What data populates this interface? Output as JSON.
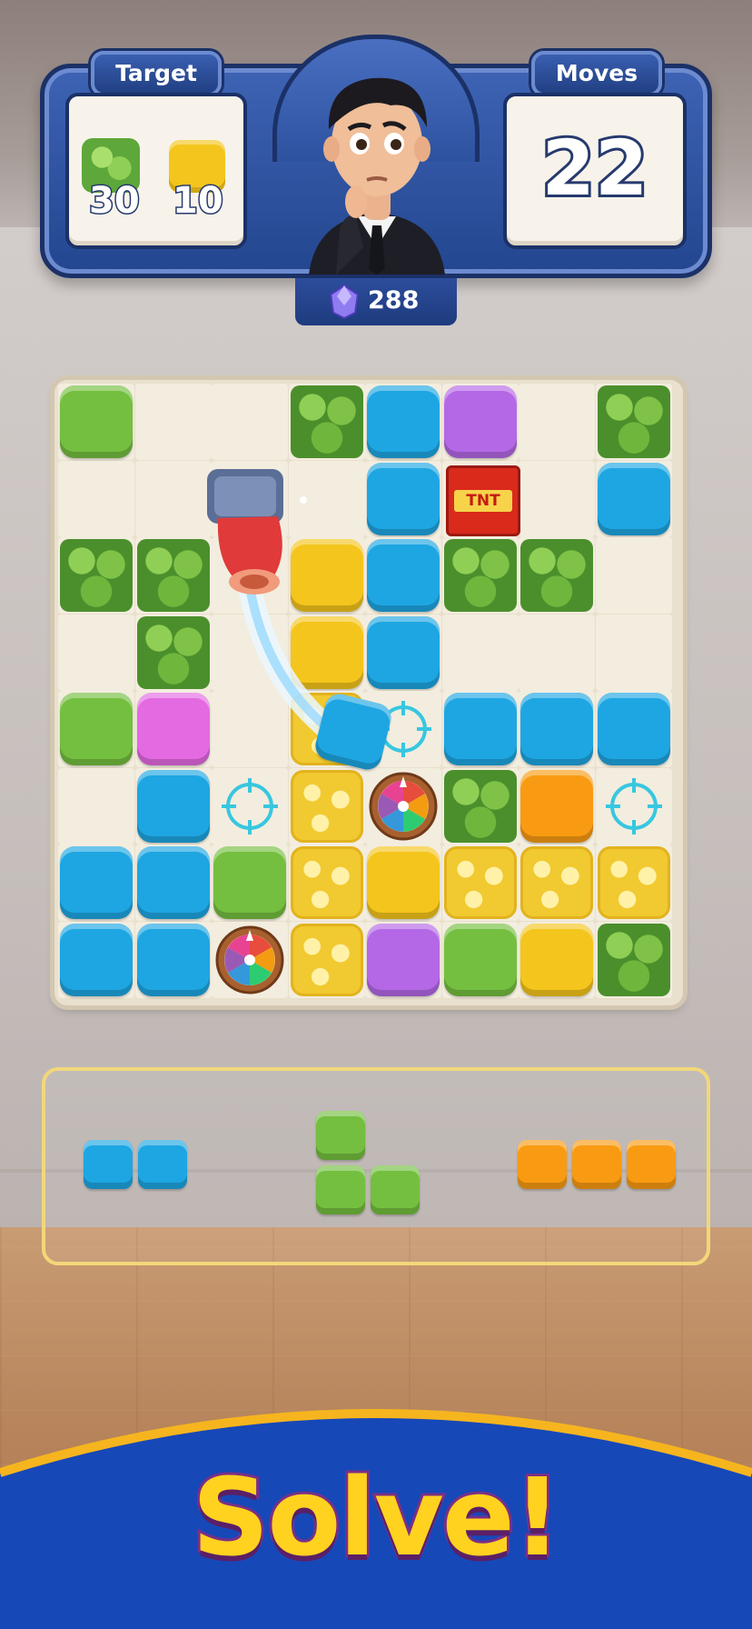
{
  "header": {
    "target_label": "Target",
    "moves_label": "Moves",
    "targets": [
      {
        "icon": "leaf-icon",
        "count": "30"
      },
      {
        "icon": "yellow-block-icon",
        "count": "10"
      }
    ],
    "moves_value": "22",
    "gems_value": "288"
  },
  "board": {
    "size": [
      8,
      8
    ],
    "rows": [
      [
        "green",
        "empty",
        "empty",
        "leaf",
        "blue",
        "purple",
        "empty",
        "leaf"
      ],
      [
        "empty",
        "empty",
        "empty",
        "empty",
        "blue",
        "tnt",
        "empty",
        "blue"
      ],
      [
        "leaf",
        "leaf",
        "empty",
        "yellow",
        "blue",
        "leaf",
        "leaf",
        "empty"
      ],
      [
        "empty",
        "leaf",
        "empty",
        "yellow",
        "blue",
        "empty",
        "empty",
        "empty"
      ],
      [
        "green",
        "pink",
        "empty",
        "cheese",
        "target",
        "blue",
        "blue",
        "blue"
      ],
      [
        "empty",
        "blue",
        "target",
        "cheese",
        "wheel",
        "leaf",
        "orange",
        "target"
      ],
      [
        "blue",
        "blue",
        "green",
        "cheese",
        "yellow",
        "cheese",
        "cheese",
        "cheese"
      ],
      [
        "blue",
        "blue",
        "wheel",
        "cheese",
        "purple",
        "green",
        "yellow",
        "leaf"
      ]
    ],
    "tnt_label": "TNT"
  },
  "tray": {
    "pieces": [
      {
        "name": "blue-domino-piece",
        "color": "blue"
      },
      {
        "name": "green-l-piece",
        "color": "green"
      },
      {
        "name": "orange-triomino-piece",
        "color": "orange"
      }
    ]
  },
  "banner": {
    "text": "Solve!"
  },
  "colors": {
    "green": "#74bf3f",
    "blue": "#1ea6e2",
    "yellow": "#f4c51c",
    "purple": "#b468e6",
    "pink": "#e46ae2",
    "orange": "#f99b12",
    "header_blue": "#2d52a0",
    "solve_yellow": "#ffd21f"
  }
}
